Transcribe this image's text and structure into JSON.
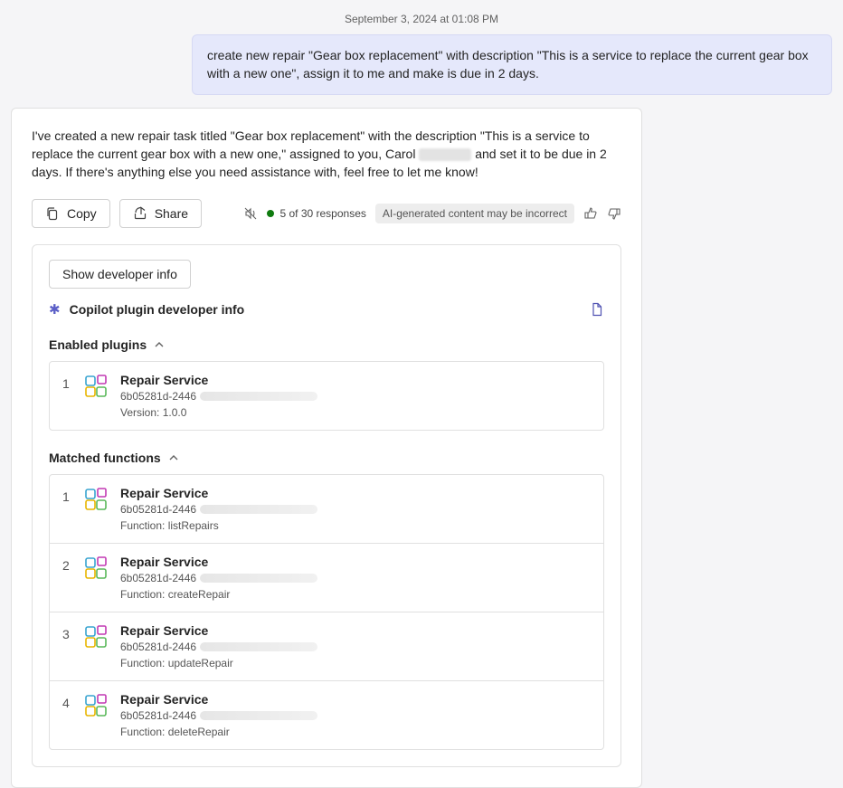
{
  "timestamp": "September 3, 2024 at 01:08 PM",
  "user_message": "create new repair \"Gear box replacement\" with description \"This is a service to replace the current gear box with a new one\", assign it to me and make is due in 2 days.",
  "ai_reply": {
    "pre": "I've created a new repair task titled \"Gear box replacement\" with the description \"This is a service to replace the current gear box with a new one,\" assigned to you, Carol ",
    "post": " and set it to be due in 2 days. If there's anything else you need assistance with, feel free to let me know!"
  },
  "buttons": {
    "copy": "Copy",
    "share": "Share"
  },
  "responses_counter": "5 of 30 responses",
  "disclaimer": "AI-generated content may be incorrect",
  "dev": {
    "show_button": "Show developer info",
    "title": "Copilot plugin developer info",
    "enabled_label": "Enabled plugins",
    "matched_label": "Matched functions",
    "plugin": {
      "name": "Repair Service",
      "id_prefix": "6b05281d-2446",
      "version": "Version: 1.0.0"
    },
    "functions": [
      {
        "name": "Repair Service",
        "id_prefix": "6b05281d-2446",
        "fn": "Function: listRepairs"
      },
      {
        "name": "Repair Service",
        "id_prefix": "6b05281d-2446",
        "fn": "Function: createRepair"
      },
      {
        "name": "Repair Service",
        "id_prefix": "6b05281d-2446",
        "fn": "Function: updateRepair"
      },
      {
        "name": "Repair Service",
        "id_prefix": "6b05281d-2446",
        "fn": "Function: deleteRepair"
      }
    ]
  }
}
